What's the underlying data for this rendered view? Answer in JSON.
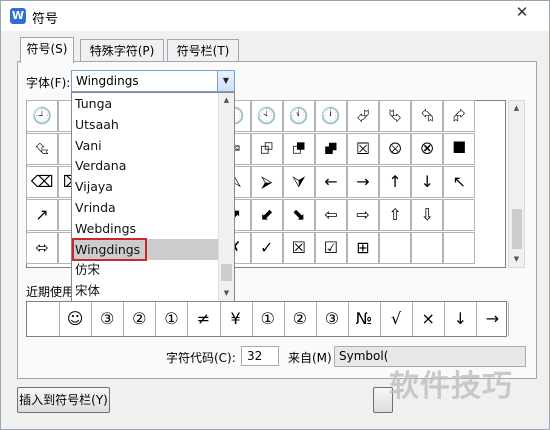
{
  "window": {
    "title": "符号",
    "close_glyph": "✕",
    "app_icon_glyph": "W"
  },
  "tabs": [
    {
      "label": "符号(S)",
      "active": true
    },
    {
      "label": "特殊字符(P)",
      "active": false
    },
    {
      "label": "符号栏(T)",
      "active": false
    }
  ],
  "font": {
    "label": "字体(F):",
    "value": "Wingdings",
    "options": [
      "Tunga",
      "Utsaah",
      "Vani",
      "Verdana",
      "Vijaya",
      "Vrinda",
      "Webdings",
      "Wingdings",
      "仿宋",
      "宋体"
    ],
    "selected": "Wingdings"
  },
  "symbols": [
    [
      "🕘",
      "",
      "",
      "",
      "",
      "",
      "🕘",
      "🕙",
      "🕚",
      "🕛",
      "⮰",
      "⮱",
      "⮲",
      "⮳"
    ],
    [
      "⮴",
      "",
      "",
      "",
      "",
      "⮸",
      "⮹",
      "⮺",
      "⮻",
      "⮼",
      "⮽",
      "⮾",
      "⮿",
      "⯀"
    ],
    [
      "⌫",
      "⌦",
      "",
      "",
      "",
      "⮘",
      "⮙",
      "⮚",
      "⮛",
      "←",
      "→",
      "↑",
      "↓",
      "↖"
    ],
    [
      "↗",
      "",
      "",
      "",
      "",
      "⬉",
      "⬈",
      "⬋",
      "⬊",
      "⇦",
      "⇨",
      "⇧",
      "⇩",
      ""
    ],
    [
      "⬄",
      "",
      "",
      "",
      "",
      "▫",
      "✗",
      "✓",
      "☒",
      "☑",
      "⊞",
      "",
      "",
      ""
    ]
  ],
  "recent": {
    "label": "近期使用",
    "items": [
      "",
      "☺",
      "③",
      "②",
      "①",
      "≠",
      "¥",
      "①",
      "②",
      "③",
      "№",
      "√",
      "×",
      "↓",
      "→"
    ]
  },
  "char_code": {
    "label": "字符代码(C):",
    "value": "32"
  },
  "from": {
    "label": "来自(M)",
    "value": "Symbol("
  },
  "buttons": {
    "insert_to_bar": "插入到符号栏(Y)"
  },
  "watermark": "软件技巧"
}
